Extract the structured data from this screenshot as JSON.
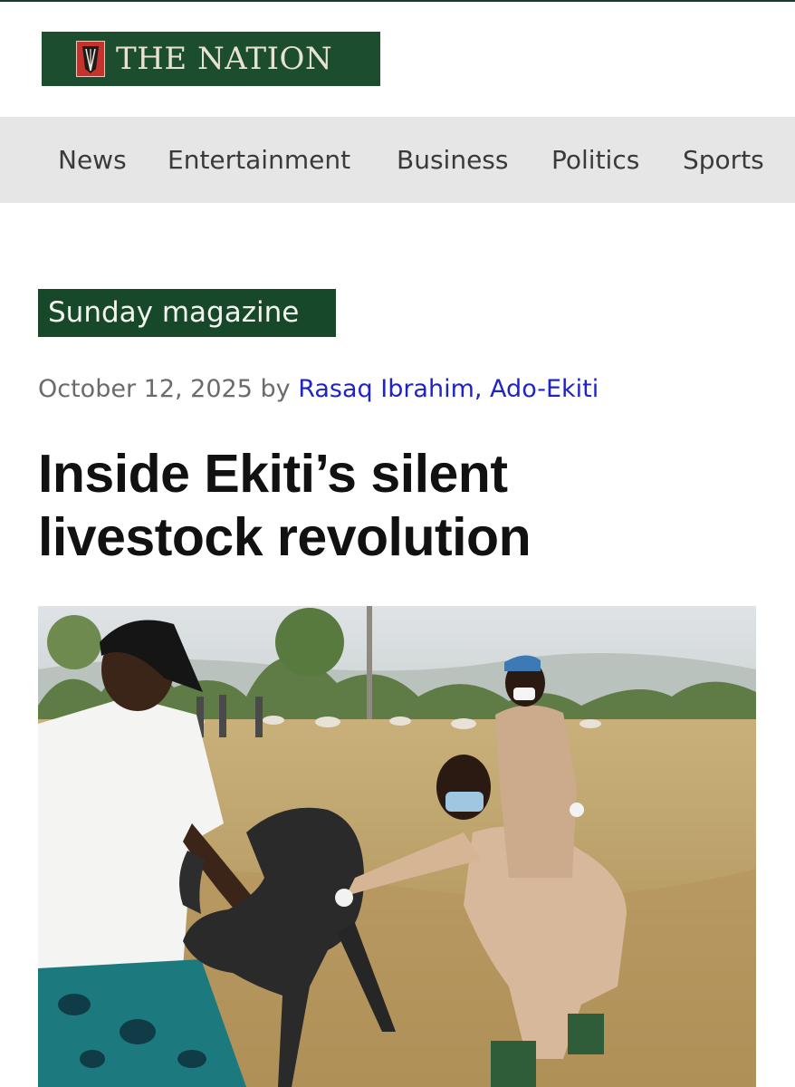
{
  "logo": {
    "text": "THE NATION",
    "icon": "crest-icon"
  },
  "nav": {
    "items": [
      "News",
      "Entertainment",
      "Business",
      "Politics",
      "Sports"
    ]
  },
  "article": {
    "category": "Sunday magazine",
    "date": "October 12, 2025",
    "by": "by",
    "author": "Rasaq Ibrahim, Ado-Ekiti",
    "headline_line1": "Inside Ekiti’s silent",
    "headline_line2": "livestock revolution"
  },
  "colors": {
    "brand_green": "#1b4d2e",
    "badge_green": "#17482a",
    "author_link": "#1f24c7",
    "nav_bg": "#e5e6e5"
  }
}
